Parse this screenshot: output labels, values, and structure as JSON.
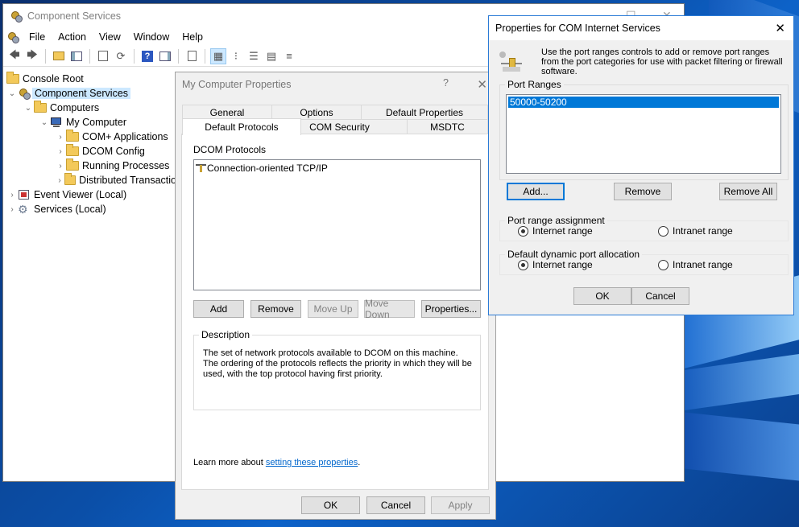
{
  "mmc": {
    "title": "Component Services",
    "menu": [
      "File",
      "Action",
      "View",
      "Window",
      "Help"
    ],
    "tree": [
      {
        "label": "Console Root"
      },
      {
        "label": "Component Services"
      },
      {
        "label": "Computers"
      },
      {
        "label": "My Computer"
      },
      {
        "label": "COM+ Applications"
      },
      {
        "label": "DCOM Config"
      },
      {
        "label": "Running Processes"
      },
      {
        "label": "Distributed Transactio"
      },
      {
        "label": "Event Viewer (Local)"
      },
      {
        "label": "Services (Local)"
      }
    ]
  },
  "mcp": {
    "title": "My Computer Properties",
    "help_glyph": "?",
    "tabs_row1": [
      "General",
      "Options",
      "Default Properties"
    ],
    "tabs_row2": [
      "Default Protocols",
      "COM Security",
      "MSDTC"
    ],
    "protocols_label": "DCOM Protocols",
    "protocols": [
      "Connection-oriented TCP/IP"
    ],
    "buttons": {
      "add": "Add",
      "remove": "Remove",
      "move_up": "Move Up",
      "move_down": "Move Down",
      "properties": "Properties..."
    },
    "description_label": "Description",
    "description": "The set of network protocols available to DCOM on this machine. The ordering of the protocols reflects the priority in which they will be used, with the top protocol having first priority.",
    "learn_more": "Learn more about ",
    "learn_more_link": "setting these properties",
    "learn_more_end": ".",
    "ok": "OK",
    "cancel": "Cancel",
    "apply": "Apply"
  },
  "pcis": {
    "title": "Properties for COM Internet Services",
    "intro": "Use the port ranges controls to add or remove port ranges from the port categories for use with packet filtering or firewall software.",
    "port_ranges_label": "Port Ranges",
    "port_ranges": [
      "50000-50200"
    ],
    "add": "Add...",
    "remove": "Remove",
    "remove_all": "Remove All",
    "assignment_label": "Port range assignment",
    "dynamic_label": "Default dynamic port allocation",
    "internet_range": "Internet range",
    "intranet_range": "Intranet range",
    "assignment_selected": "Internet range",
    "dynamic_selected": "Internet range",
    "ok": "OK",
    "cancel": "Cancel"
  },
  "colors": {
    "selection": "#0078d7",
    "tree_selection": "#cce8ff",
    "link": "#0066cc"
  }
}
